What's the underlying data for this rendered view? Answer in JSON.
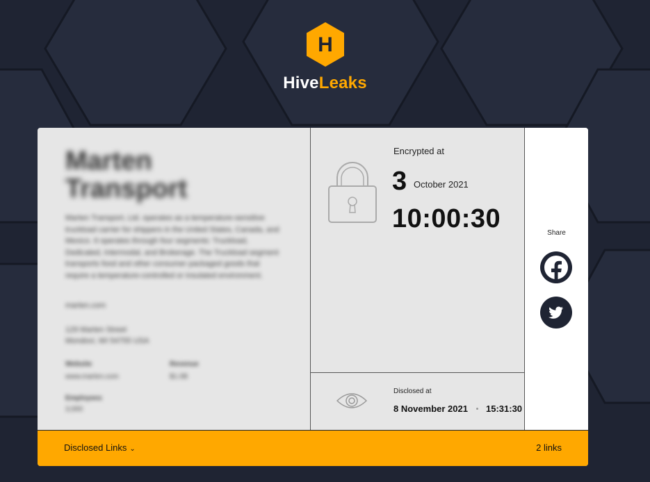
{
  "brand": {
    "part1": "Hive",
    "part2": "Leaks",
    "logo_letter": "H",
    "accent": "#ffa800",
    "background": "#1f2433"
  },
  "company": {
    "name_line1": "Marten",
    "name_line2": "Transport",
    "description": "Marten Transport, Ltd. operates as a temperature-sensitive truckload carrier for shippers in the United States, Canada, and Mexico. It operates through four segments: Truckload, Dedicated, Intermodal, and Brokerage. The Truckload segment transports food and other consumer packaged goods that require a temperature-controlled or insulated environment.",
    "website_link": "marten.com",
    "address_line1": "129 Marten Street",
    "address_line2": "Mondovi, WI 54755 USA",
    "meta": [
      {
        "key": "Website",
        "value": "www.marten.com"
      },
      {
        "key": "Revenue",
        "value": "$1.0B"
      },
      {
        "key": "Employees",
        "value": "3,000"
      }
    ]
  },
  "encrypted": {
    "label": "Encrypted at",
    "day": "3",
    "month_year": "October 2021",
    "time": "10:00:30"
  },
  "disclosed": {
    "label": "Disclosed at",
    "date": "8 November 2021",
    "time": "15:31:30"
  },
  "share": {
    "label": "Share",
    "icons": [
      "facebook-icon",
      "twitter-icon"
    ]
  },
  "footer": {
    "links_label": "Disclosed Links",
    "links_count": "2 links"
  }
}
